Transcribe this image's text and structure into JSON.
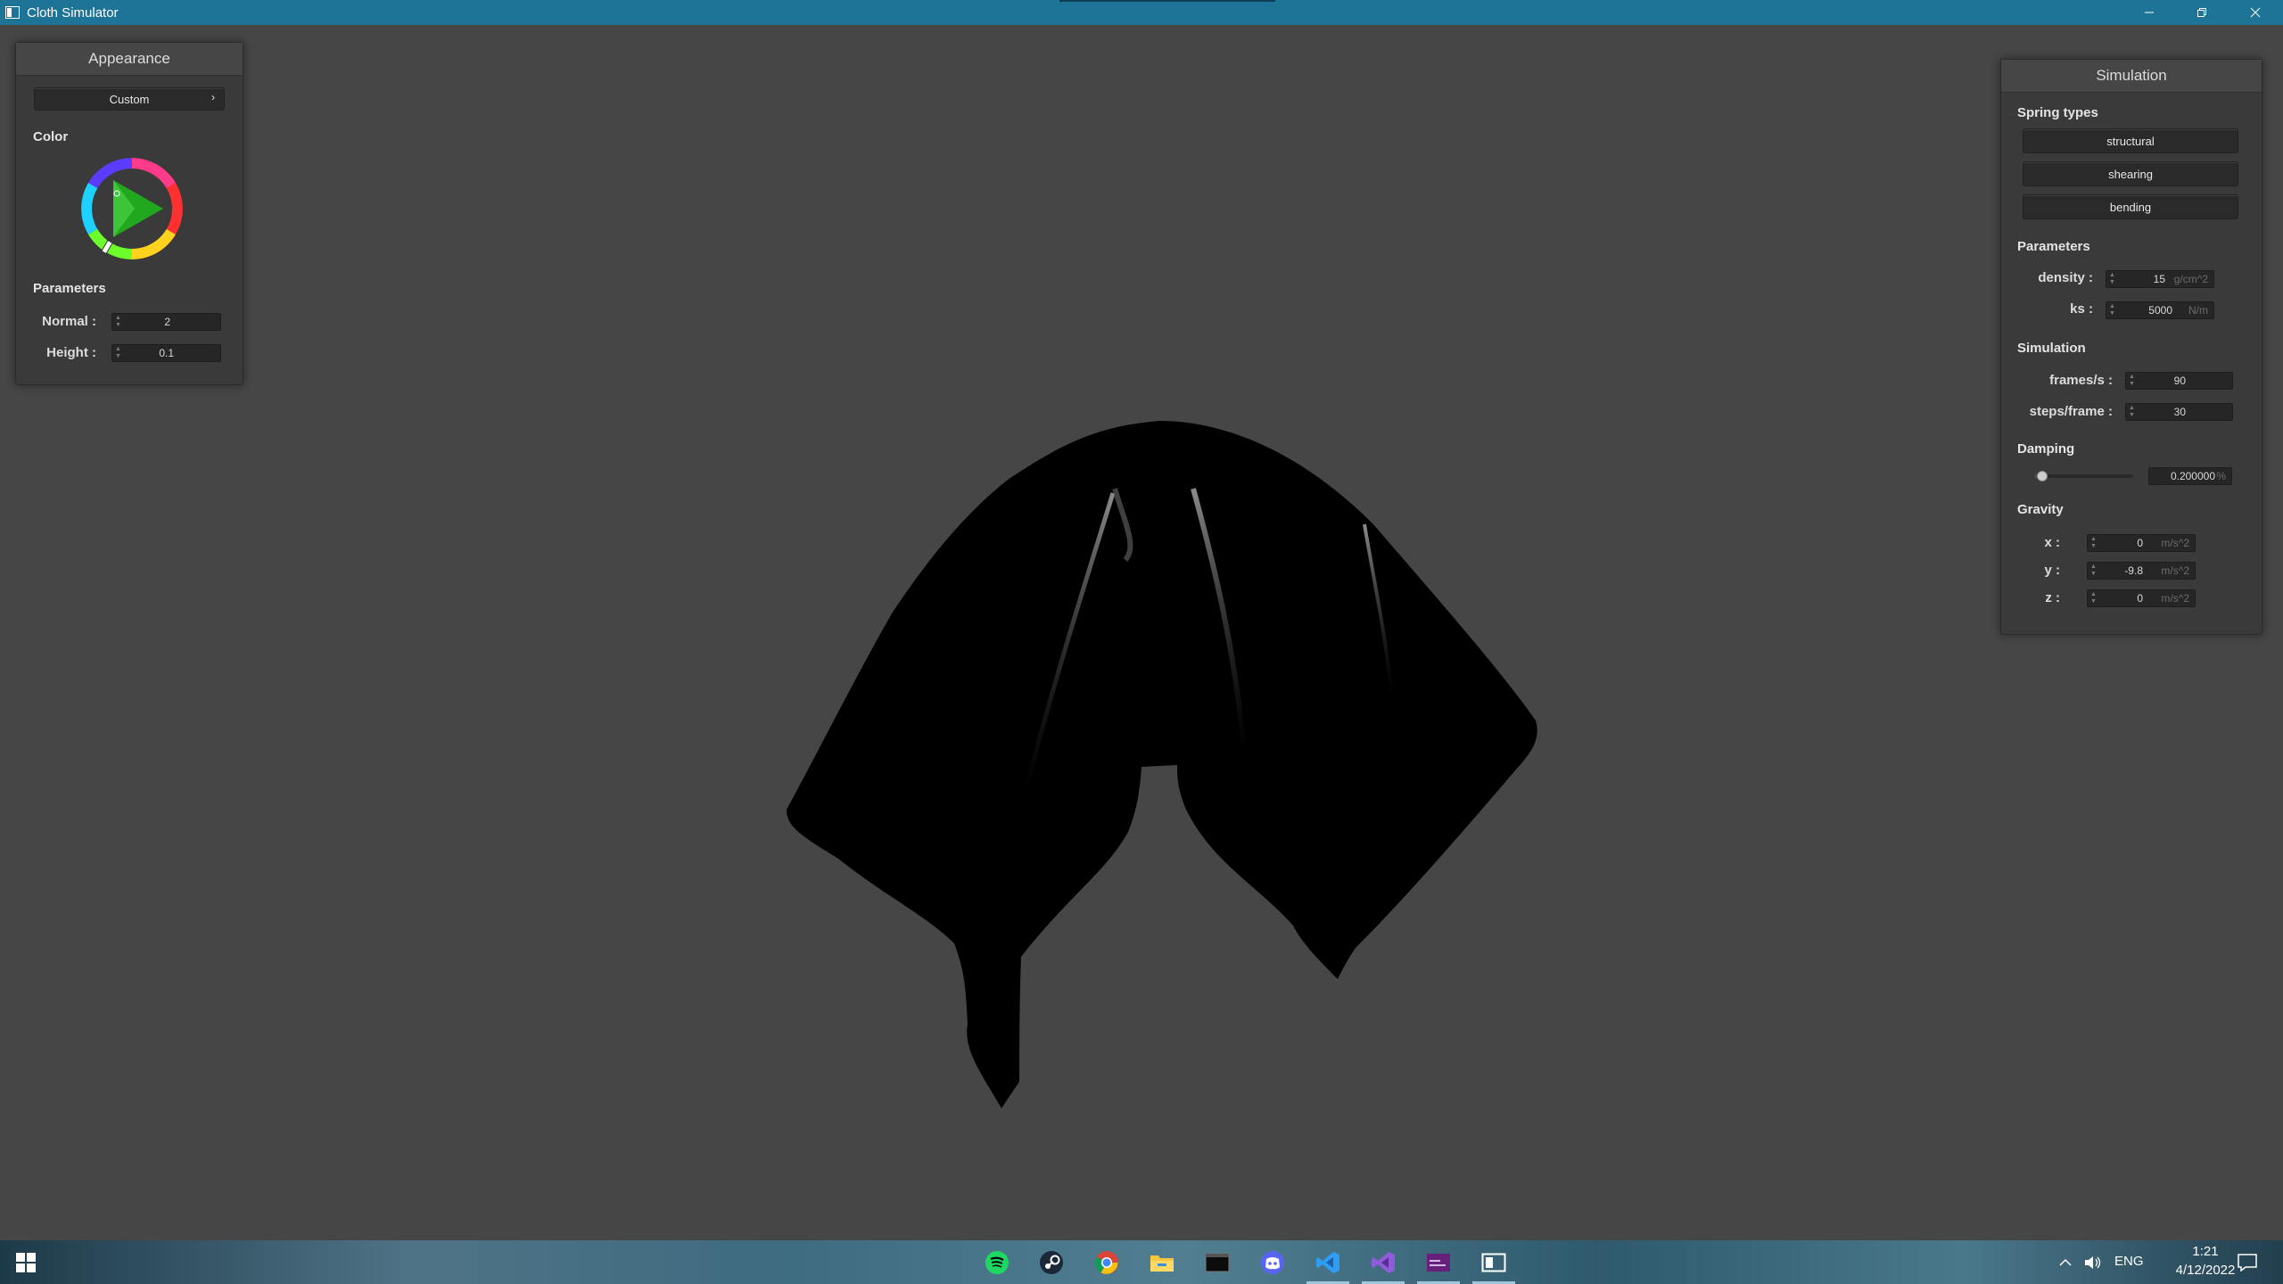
{
  "window": {
    "title": "Cloth Simulator"
  },
  "appearance": {
    "header": "Appearance",
    "preset": "Custom",
    "color_label": "Color",
    "params_label": "Parameters",
    "normal_label": "Normal :",
    "normal_value": "2",
    "height_label": "Height :",
    "height_value": "0.1"
  },
  "simulation": {
    "header": "Simulation",
    "spring_types_label": "Spring types",
    "springs": [
      "structural",
      "shearing",
      "bending"
    ],
    "params_label": "Parameters",
    "density_label": "density :",
    "density_value": "15",
    "density_unit": "g/cm^2",
    "ks_label": "ks :",
    "ks_value": "5000",
    "ks_unit": "N/m",
    "sim_label": "Simulation",
    "fps_label": "frames/s :",
    "fps_value": "90",
    "steps_label": "steps/frame :",
    "steps_value": "30",
    "damping_label": "Damping",
    "damping_value": "0.200000",
    "damping_unit": "%",
    "damping_fraction": 0.2,
    "gravity_label": "Gravity",
    "gx_label": "x :",
    "gx_value": "0",
    "gy_label": "y :",
    "gy_value": "-9.8",
    "gz_label": "z :",
    "gz_value": "0",
    "gravity_unit": "m/s^2"
  },
  "taskbar": {
    "apps": [
      "spotify-icon",
      "steam-icon",
      "chrome-icon",
      "file-explorer-icon",
      "terminal-icon",
      "discord-icon",
      "vscode-icon",
      "visual-studio-icon",
      "visual-studio-2-icon",
      "cloth-simulator-icon"
    ],
    "language": "ENG",
    "time": "1:21",
    "date": "4/12/2022"
  },
  "colors": {
    "titlebar": "#1e7496",
    "viewport": "#464646",
    "panel": "#3a3a3a"
  }
}
